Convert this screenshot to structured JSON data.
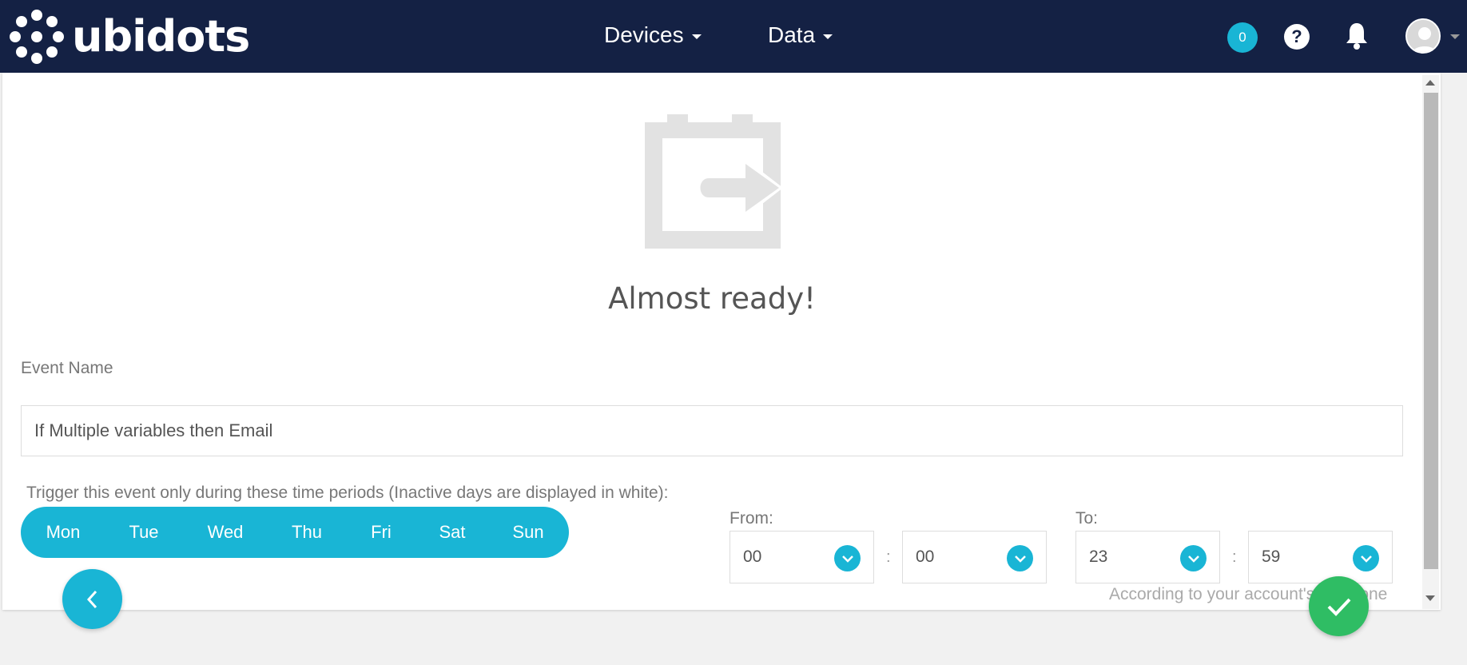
{
  "brand": {
    "name": "ubidots",
    "nav_color": "#142144",
    "accent": "#19b5d5",
    "success": "#2fbd64"
  },
  "nav": {
    "devices_label": "Devices",
    "data_label": "Data",
    "notification_count": "0",
    "help_icon": "question-circle-icon",
    "bell_icon": "bell-icon",
    "avatar_icon": "user-avatar-icon"
  },
  "page": {
    "title": "Almost ready!",
    "hero_icon": "event-export-icon",
    "event_name_label": "Event Name",
    "event_name_value": "If Multiple variables then Email",
    "trigger_label": "Trigger this event only during these time periods (Inactive days are displayed in white):",
    "days": [
      "Mon",
      "Tue",
      "Wed",
      "Thu",
      "Fri",
      "Sat",
      "Sun"
    ],
    "from_label": "From:",
    "to_label": "To:",
    "from_hour": "00",
    "from_minute": "00",
    "to_hour": "23",
    "to_minute": "59",
    "colon": ":",
    "timezone_note": "According to your account's timezone"
  },
  "actions": {
    "back_icon": "chevron-left-icon",
    "confirm_icon": "check-icon"
  }
}
